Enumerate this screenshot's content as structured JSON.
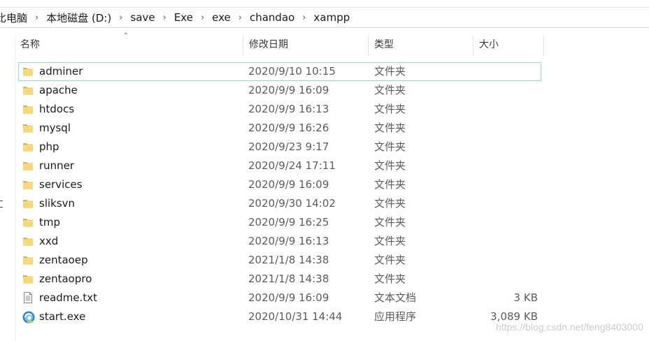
{
  "breadcrumb": [
    "比电脑",
    "本地磁盘 (D:)",
    "save",
    "Exe",
    "exe",
    "chandao",
    "xampp"
  ],
  "columns": {
    "name": "名称",
    "date": "修改日期",
    "type": "类型",
    "size": "大小"
  },
  "files": [
    {
      "name": "adminer",
      "date": "2020/9/10 10:15",
      "type": "文件夹",
      "size": "",
      "icon": "folder-icon",
      "selected": true
    },
    {
      "name": "apache",
      "date": "2020/9/9 16:09",
      "type": "文件夹",
      "size": "",
      "icon": "folder-icon"
    },
    {
      "name": "htdocs",
      "date": "2020/9/9 16:13",
      "type": "文件夹",
      "size": "",
      "icon": "folder-icon"
    },
    {
      "name": "mysql",
      "date": "2020/9/9 16:26",
      "type": "文件夹",
      "size": "",
      "icon": "folder-icon"
    },
    {
      "name": "php",
      "date": "2020/9/23 9:17",
      "type": "文件夹",
      "size": "",
      "icon": "folder-icon"
    },
    {
      "name": "runner",
      "date": "2020/9/24 17:11",
      "type": "文件夹",
      "size": "",
      "icon": "folder-icon"
    },
    {
      "name": "services",
      "date": "2020/9/9 16:09",
      "type": "文件夹",
      "size": "",
      "icon": "folder-icon"
    },
    {
      "name": "sliksvn",
      "date": "2020/9/30 14:02",
      "type": "文件夹",
      "size": "",
      "icon": "folder-icon"
    },
    {
      "name": "tmp",
      "date": "2020/9/9 16:25",
      "type": "文件夹",
      "size": "",
      "icon": "folder-icon"
    },
    {
      "name": "xxd",
      "date": "2020/9/9 16:13",
      "type": "文件夹",
      "size": "",
      "icon": "folder-icon"
    },
    {
      "name": "zentaoep",
      "date": "2021/1/8 14:38",
      "type": "文件夹",
      "size": "",
      "icon": "folder-icon"
    },
    {
      "name": "zentaopro",
      "date": "2021/1/8 14:38",
      "type": "文件夹",
      "size": "",
      "icon": "folder-icon"
    },
    {
      "name": "readme.txt",
      "date": "2020/9/9 16:09",
      "type": "文本文档",
      "size": "3 KB",
      "icon": "text-file-icon"
    },
    {
      "name": "start.exe",
      "date": "2020/10/31 14:44",
      "type": "应用程序",
      "size": "3,089 KB",
      "icon": "exe-app-icon"
    }
  ],
  "watermark": "https://blog.csdn.net/feng8403000"
}
